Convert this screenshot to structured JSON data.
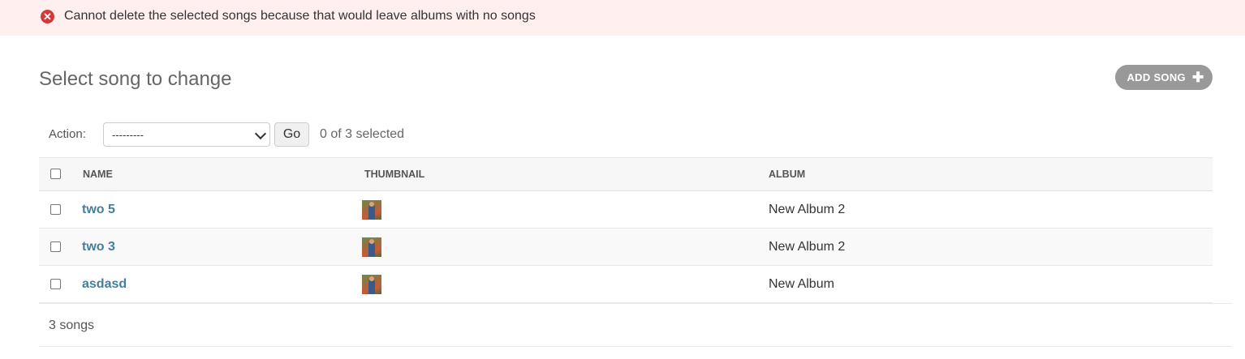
{
  "message": {
    "icon": "error-circle-icon",
    "text": "Cannot delete the selected songs because that would leave albums with no songs",
    "background": "#ffefef",
    "icon_color": "#cf3b3b"
  },
  "page": {
    "title": "Select song to change",
    "add_button": {
      "label": "ADD SONG",
      "icon": "plus-icon"
    }
  },
  "actions": {
    "label": "Action:",
    "selected_option": "---------",
    "go_label": "Go",
    "selection_count": "0 of 3 selected"
  },
  "table": {
    "columns": [
      "NAME",
      "THUMBNAIL",
      "ALBUM"
    ],
    "rows": [
      {
        "name": "two 5",
        "thumbnail": "song-thumbnail-image",
        "album": "New Album 2"
      },
      {
        "name": "two 3",
        "thumbnail": "song-thumbnail-image",
        "album": "New Album 2"
      },
      {
        "name": "asdasd",
        "thumbnail": "song-thumbnail-image",
        "album": "New Album"
      }
    ]
  },
  "paginator": {
    "text": "3 songs"
  },
  "colors": {
    "link": "#447e9b",
    "button": "#999999"
  }
}
